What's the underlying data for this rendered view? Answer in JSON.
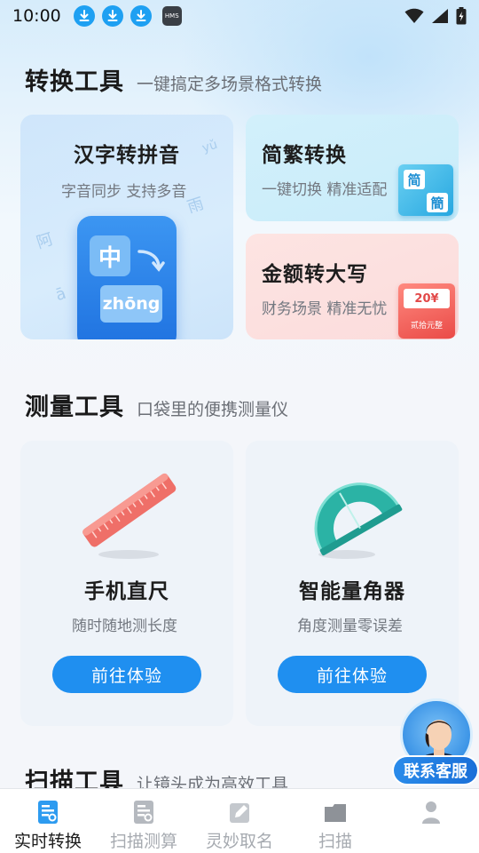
{
  "status_bar": {
    "time": "10:00",
    "hms_label": "HMS"
  },
  "sections": {
    "convert": {
      "title": "转换工具",
      "subtitle": "一键搞定多场景格式转换"
    },
    "measure": {
      "title": "测量工具",
      "subtitle": "口袋里的便携测量仪"
    },
    "scan": {
      "title": "扫描工具",
      "subtitle": "让镜头成为高效工具"
    }
  },
  "convert_cards": {
    "pinyin": {
      "title": "汉字转拼音",
      "subtitle": "字音同步 支持多音",
      "tile_char": "中",
      "tile_pinyin": "zhōng",
      "faint_chars": [
        "阿",
        "雨",
        "ā",
        "yǔ"
      ]
    },
    "jianfan": {
      "title": "简繁转换",
      "subtitle": "一键切换 精准适配",
      "char_simplified": "简",
      "char_traditional": "簡"
    },
    "money": {
      "title": "金额转大写",
      "subtitle": "财务场景 精准无忧",
      "amount": "20¥",
      "amount_upper": "贰拾元整"
    }
  },
  "measure_cards": {
    "ruler": {
      "title": "手机直尺",
      "subtitle": "随时随地测长度",
      "button": "前往体验"
    },
    "protractor": {
      "title": "智能量角器",
      "subtitle": "角度测量零误差",
      "button": "前往体验"
    }
  },
  "customer_service": {
    "label": "联系客服"
  },
  "bottom_nav": [
    {
      "label": "实时转换",
      "icon": "convert-icon",
      "active": true
    },
    {
      "label": "扫描测算",
      "icon": "scan-calc-icon",
      "active": false
    },
    {
      "label": "灵妙取名",
      "icon": "naming-icon",
      "active": false
    },
    {
      "label": "扫描",
      "icon": "folder-icon",
      "active": false
    },
    {
      "label": "",
      "icon": "profile-icon",
      "active": false
    }
  ],
  "colors": {
    "accent": "#1f8ff0",
    "download_icon": "#1ea0f2",
    "nav_inactive": "#a6aab0"
  }
}
